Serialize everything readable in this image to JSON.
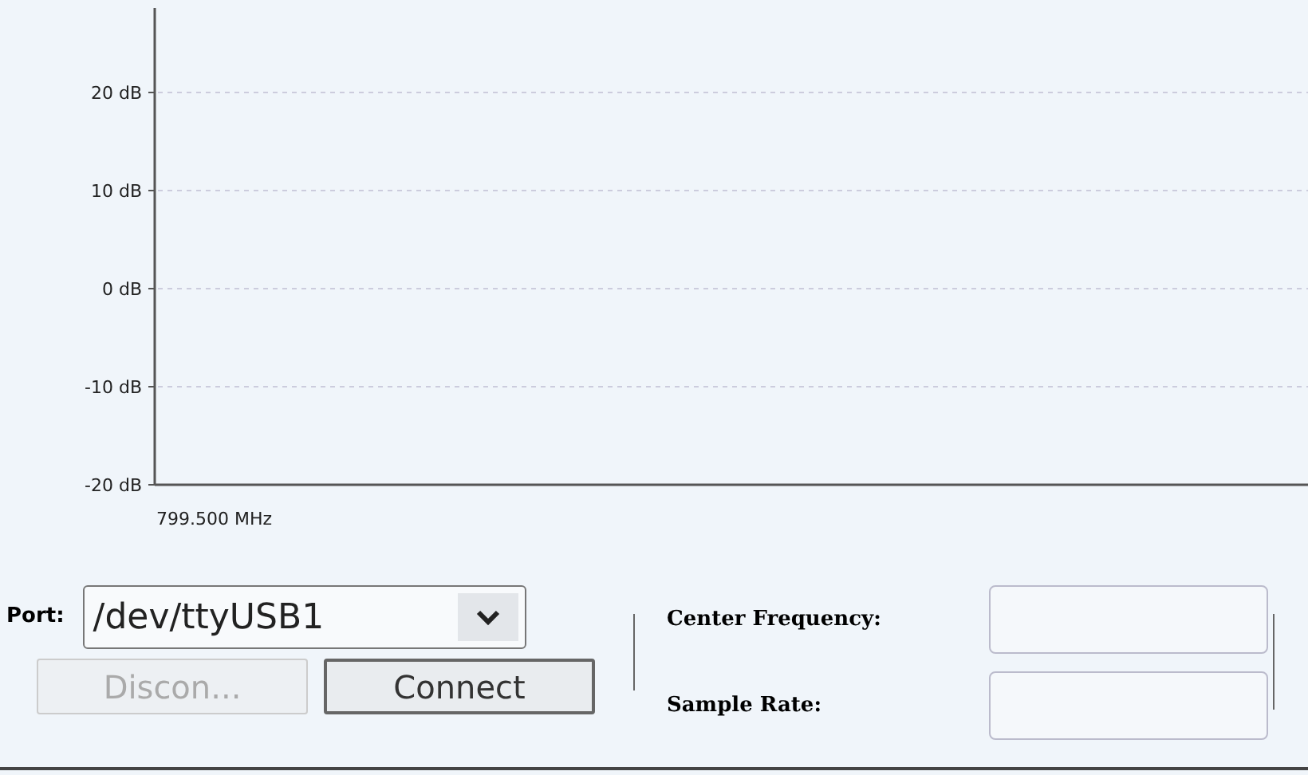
{
  "spectrum": {
    "y_axis_labels": [
      "20 dB",
      "10 dB",
      "0 dB",
      "-10 dB",
      "-20 dB"
    ],
    "frequency_label": "799.500 MHz"
  },
  "connection": {
    "port_label": "Port:",
    "port_value": "/dev/ttyUSB1",
    "buttons": [
      {
        "label": "Discon...",
        "disabled": true
      },
      {
        "label": "Connect",
        "disabled": false
      }
    ]
  },
  "settings": [
    {
      "label": "Center Frequency:"
    },
    {
      "label": "Sample Rate:"
    }
  ]
}
